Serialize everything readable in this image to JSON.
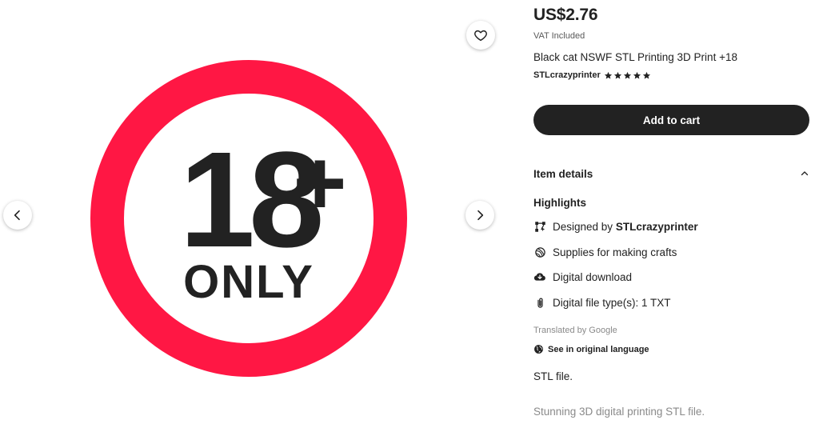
{
  "gallery": {
    "image_alt": "18+ ONLY",
    "badge_number": "18",
    "badge_plus": "+",
    "badge_word": "ONLY",
    "colors": {
      "ring": "#ff1744",
      "text": "#222222"
    },
    "icons": {
      "favorite": "heart-icon",
      "prev": "chevron-left-icon",
      "next": "chevron-right-icon"
    }
  },
  "product": {
    "price": "US$2.76",
    "vat": "VAT Included",
    "title": "Black cat NSWF STL Printing 3D Print +18",
    "shop_name": "STLcrazyprinter",
    "rating_stars": 5,
    "add_to_cart": "Add to cart"
  },
  "details": {
    "header": "Item details",
    "highlights_title": "Highlights",
    "designed_prefix": "Designed by",
    "designed_by": "STLcrazyprinter",
    "supplies": "Supplies for making crafts",
    "digital_download": "Digital download",
    "file_types": "Digital file type(s): 1 TXT",
    "translated_by": "Translated by Google",
    "see_original": "See in original language",
    "description_line1": "STL file.",
    "description_line2": "Stunning 3D digital printing STL file."
  }
}
